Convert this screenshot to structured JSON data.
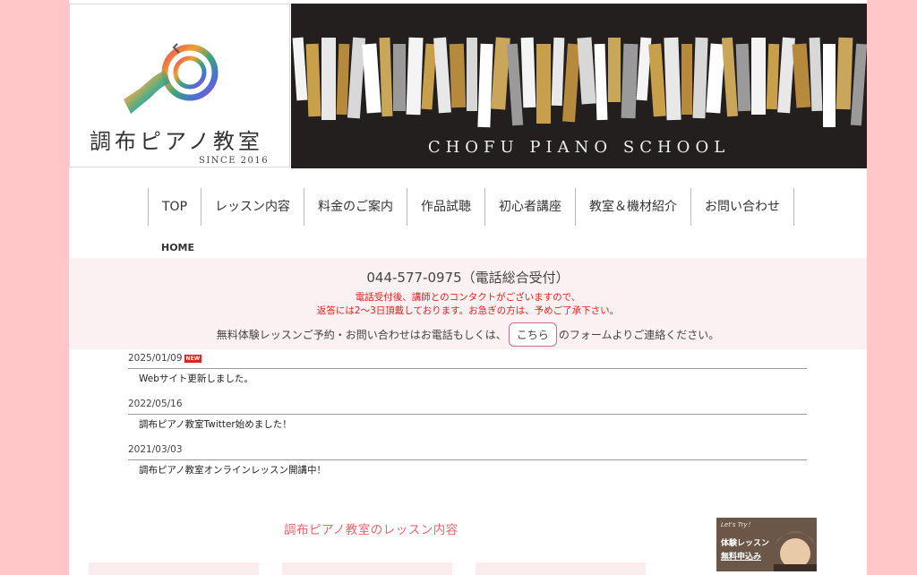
{
  "header": {
    "logo_title": "調布ピアノ教室",
    "logo_since": "SINCE 2016",
    "banner_title": "CHOFU PIANO SCHOOL"
  },
  "nav": {
    "items": [
      {
        "label": "TOP"
      },
      {
        "label": "レッスン内容"
      },
      {
        "label": "料金のご案内"
      },
      {
        "label": "作品試聴"
      },
      {
        "label": "初心者講座"
      },
      {
        "label": "教室＆機材紹介"
      },
      {
        "label": "お問い合わせ"
      }
    ]
  },
  "breadcrumb": "HOME",
  "info": {
    "phone": "044-577-0975（電話総合受付）",
    "note_line1": "電話受付後、講師とのコンタクトがございますので、",
    "note_line2": "返答には2〜3日頂戴しております。お急ぎの方は、予めご了承下さい。",
    "contact_prefix": "無料体験レッスンご予約・お問い合わせはお電話もしくは、",
    "contact_link": "こちら",
    "contact_suffix": "のフォームよりご連絡ください。"
  },
  "news": [
    {
      "date": "2025/01/09",
      "badge": "NEW",
      "title": "Webサイト更新しました。"
    },
    {
      "date": "2022/05/16",
      "badge": "",
      "title": "調布ピアノ教室Twitter始めました！"
    },
    {
      "date": "2021/03/03",
      "badge": "",
      "title": "調布ピアノ教室オンラインレッスン開講中！"
    }
  ],
  "lesson": {
    "heading": "調布ピアノ教室のレッスン内容"
  },
  "trial_banner": {
    "lets_try": "Let's Try！",
    "line1": "体験レッスン",
    "line2": "無料申込み"
  },
  "colors": {
    "outer_background": "#ffc7c7",
    "banner_background": "#231f1f",
    "info_background": "#fbf1f3",
    "note_red": "#e0221c",
    "heading_pink": "#e8666a"
  }
}
